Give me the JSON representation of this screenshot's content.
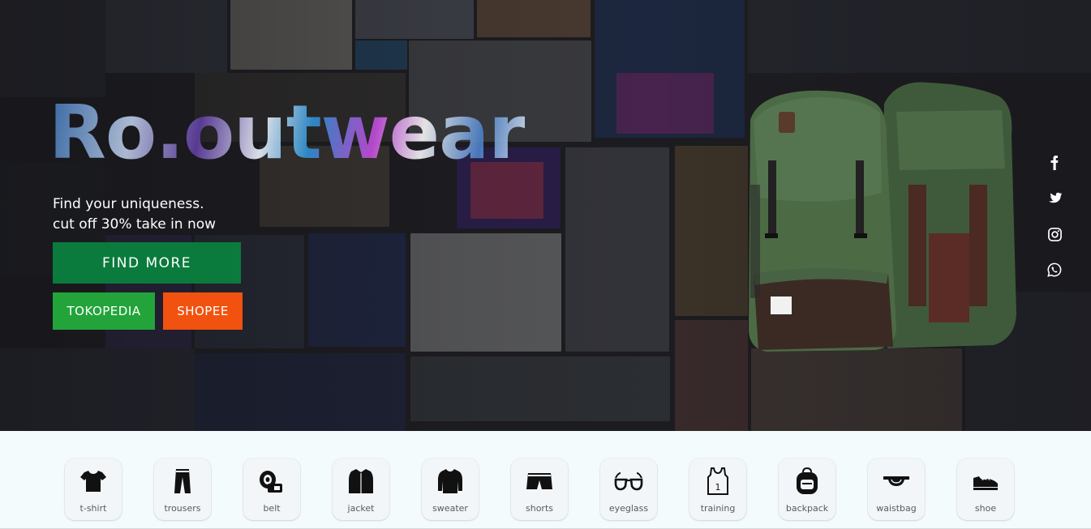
{
  "hero": {
    "brand": "Ro.outwear",
    "tagline_line1": "Find your uniqueness.",
    "tagline_line2": "cut off 30% take in now",
    "find_more_label": "FIND MORE",
    "tokopedia_label": "TOKOPEDIA",
    "shopee_label": "SHOPEE",
    "colors": {
      "find_more": "#0a7b3c",
      "tokopedia": "#22a43b",
      "shopee": "#f1520f"
    }
  },
  "social": [
    {
      "name": "facebook-icon"
    },
    {
      "name": "twitter-icon"
    },
    {
      "name": "instagram-icon"
    },
    {
      "name": "whatsapp-icon"
    }
  ],
  "categories": [
    {
      "label": "t-shirt",
      "icon": "tshirt-icon"
    },
    {
      "label": "trousers",
      "icon": "trousers-icon"
    },
    {
      "label": "belt",
      "icon": "belt-icon"
    },
    {
      "label": "jacket",
      "icon": "jacket-icon"
    },
    {
      "label": "sweater",
      "icon": "sweater-icon"
    },
    {
      "label": "shorts",
      "icon": "shorts-icon"
    },
    {
      "label": "eyeglass",
      "icon": "eyeglass-icon"
    },
    {
      "label": "training",
      "icon": "training-icon"
    },
    {
      "label": "backpack",
      "icon": "backpack-icon"
    },
    {
      "label": "waistbag",
      "icon": "waistbag-icon"
    },
    {
      "label": "shoe",
      "icon": "shoe-icon"
    }
  ]
}
